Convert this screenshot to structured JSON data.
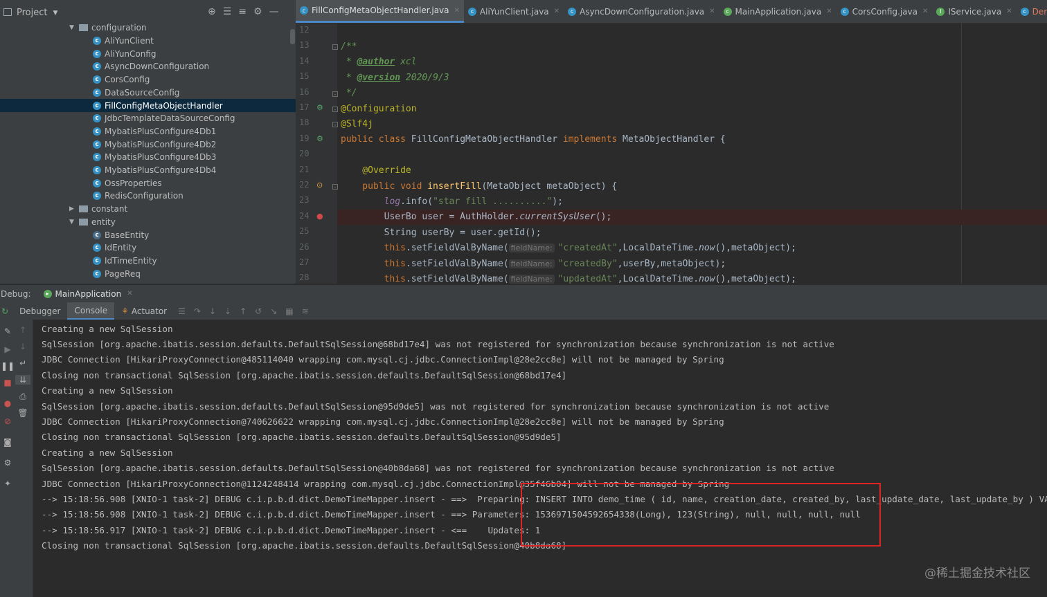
{
  "project_panel": {
    "title": "Project",
    "tree": [
      {
        "label": "configuration",
        "type": "folder",
        "open": true,
        "indent": 1
      },
      {
        "label": "AliYunClient",
        "type": "class",
        "indent": 2
      },
      {
        "label": "AliYunConfig",
        "type": "class",
        "indent": 2
      },
      {
        "label": "AsyncDownConfiguration",
        "type": "class",
        "indent": 2
      },
      {
        "label": "CorsConfig",
        "type": "class",
        "indent": 2
      },
      {
        "label": "DataSourceConfig",
        "type": "class",
        "indent": 2
      },
      {
        "label": "FillConfigMetaObjectHandler",
        "type": "class",
        "indent": 2,
        "selected": true
      },
      {
        "label": "JdbcTemplateDataSourceConfig",
        "type": "class",
        "indent": 2
      },
      {
        "label": "MybatisPlusConfigure4Db1",
        "type": "class",
        "indent": 2
      },
      {
        "label": "MybatisPlusConfigure4Db2",
        "type": "class",
        "indent": 2
      },
      {
        "label": "MybatisPlusConfigure4Db3",
        "type": "class",
        "indent": 2
      },
      {
        "label": "MybatisPlusConfigure4Db4",
        "type": "class",
        "indent": 2
      },
      {
        "label": "OssProperties",
        "type": "class",
        "indent": 2
      },
      {
        "label": "RedisConfiguration",
        "type": "class",
        "indent": 2
      },
      {
        "label": "constant",
        "type": "folder",
        "open": false,
        "indent": 1
      },
      {
        "label": "entity",
        "type": "folder",
        "open": true,
        "indent": 1
      },
      {
        "label": "BaseEntity",
        "type": "abstract",
        "indent": 2
      },
      {
        "label": "IdEntity",
        "type": "class",
        "indent": 2
      },
      {
        "label": "IdTimeEntity",
        "type": "class",
        "indent": 2
      },
      {
        "label": "PageReq",
        "type": "class",
        "indent": 2
      }
    ]
  },
  "editor_tabs": [
    {
      "label": "FillConfigMetaObjectHandler.java",
      "active": true,
      "icon": "class-icon"
    },
    {
      "label": "AliYunClient.java",
      "icon": "class-icon"
    },
    {
      "label": "AsyncDownConfiguration.java",
      "icon": "class-icon"
    },
    {
      "label": "MainApplication.java",
      "icon": "spring-class-icon"
    },
    {
      "label": "CorsConfig.java",
      "icon": "class-icon"
    },
    {
      "label": "IService.java",
      "icon": "interface-icon"
    },
    {
      "label": "DemoTime.java",
      "icon": "class-icon",
      "modified": true
    }
  ],
  "code": {
    "line_numbers": [
      "12",
      "13",
      "14",
      "15",
      "16",
      "17",
      "18",
      "19",
      "20",
      "21",
      "22",
      "23",
      "24",
      "25",
      "26",
      "27",
      "28"
    ],
    "lines": [
      {
        "parts": []
      },
      {
        "parts": [
          {
            "t": "/**",
            "c": "doc"
          }
        ]
      },
      {
        "parts": [
          {
            "t": " * ",
            "c": "doc"
          },
          {
            "t": "@author",
            "c": "doctag"
          },
          {
            "t": " xcl",
            "c": "doc"
          }
        ]
      },
      {
        "parts": [
          {
            "t": " * ",
            "c": "doc"
          },
          {
            "t": "@version",
            "c": "doctag"
          },
          {
            "t": " 2020/9/3",
            "c": "doc"
          }
        ]
      },
      {
        "parts": [
          {
            "t": " */",
            "c": "doc"
          }
        ]
      },
      {
        "parts": [
          {
            "t": "@Configuration",
            "c": "ann"
          }
        ]
      },
      {
        "parts": [
          {
            "t": "@Slf4j",
            "c": "ann"
          }
        ]
      },
      {
        "parts": [
          {
            "t": "public class ",
            "c": "kw"
          },
          {
            "t": "FillConfigMetaObjectHandler ",
            "c": ""
          },
          {
            "t": "implements ",
            "c": "kw"
          },
          {
            "t": "MetaObjectHandler {",
            "c": ""
          }
        ]
      },
      {
        "parts": []
      },
      {
        "parts": [
          {
            "t": "    @Override",
            "c": "ann"
          }
        ]
      },
      {
        "parts": [
          {
            "t": "    public void ",
            "c": "kw"
          },
          {
            "t": "insertFill",
            "c": "fn"
          },
          {
            "t": "(MetaObject metaObject) {",
            "c": ""
          }
        ]
      },
      {
        "parts": [
          {
            "t": "        ",
            "c": ""
          },
          {
            "t": "log",
            "c": "field"
          },
          {
            "t": ".info(",
            "c": ""
          },
          {
            "t": "\"star fill ..........\"",
            "c": "str"
          },
          {
            "t": ");",
            "c": ""
          }
        ]
      },
      {
        "parts": [
          {
            "t": "        UserBo user = AuthHolder.",
            "c": ""
          },
          {
            "t": "currentSysUser",
            "c": "ital"
          },
          {
            "t": "();",
            "c": ""
          }
        ],
        "breakpoint": true
      },
      {
        "parts": [
          {
            "t": "        String userBy = user.getId();",
            "c": ""
          }
        ]
      },
      {
        "parts": [
          {
            "t": "        ",
            "c": ""
          },
          {
            "t": "this",
            "c": "kw"
          },
          {
            "t": ".setFieldValByName(",
            "c": ""
          },
          {
            "t": "fieldName:",
            "c": "hint"
          },
          {
            "t": "\"createdAt\"",
            "c": "str"
          },
          {
            "t": ",LocalDateTime.",
            "c": ""
          },
          {
            "t": "now",
            "c": "ital"
          },
          {
            "t": "(),metaObject);",
            "c": ""
          }
        ]
      },
      {
        "parts": [
          {
            "t": "        ",
            "c": ""
          },
          {
            "t": "this",
            "c": "kw"
          },
          {
            "t": ".setFieldValByName(",
            "c": ""
          },
          {
            "t": "fieldName:",
            "c": "hint"
          },
          {
            "t": "\"createdBy\"",
            "c": "str"
          },
          {
            "t": ",userBy,metaObject);",
            "c": ""
          }
        ]
      },
      {
        "parts": [
          {
            "t": "        ",
            "c": ""
          },
          {
            "t": "this",
            "c": "kw"
          },
          {
            "t": ".setFieldValByName(",
            "c": ""
          },
          {
            "t": "fieldName:",
            "c": "hint"
          },
          {
            "t": "\"updatedAt\"",
            "c": "str"
          },
          {
            "t": ",LocalDateTime.",
            "c": ""
          },
          {
            "t": "now",
            "c": "ital"
          },
          {
            "t": "(),metaObject);",
            "c": ""
          }
        ]
      }
    ]
  },
  "debug": {
    "label": "Debug:",
    "config": "MainApplication",
    "tabs": [
      "Debugger",
      "Console",
      "Actuator"
    ],
    "active_tab": "Console"
  },
  "console_lines": [
    "Creating a new SqlSession",
    "SqlSession [org.apache.ibatis.session.defaults.DefaultSqlSession@68bd17e4] was not registered for synchronization because synchronization is not active",
    "JDBC Connection [HikariProxyConnection@485114040 wrapping com.mysql.cj.jdbc.ConnectionImpl@28e2cc8e] will not be managed by Spring",
    "Closing non transactional SqlSession [org.apache.ibatis.session.defaults.DefaultSqlSession@68bd17e4]",
    "Creating a new SqlSession",
    "SqlSession [org.apache.ibatis.session.defaults.DefaultSqlSession@95d9de5] was not registered for synchronization because synchronization is not active",
    "JDBC Connection [HikariProxyConnection@740626622 wrapping com.mysql.cj.jdbc.ConnectionImpl@28e2cc8e] will not be managed by Spring",
    "Closing non transactional SqlSession [org.apache.ibatis.session.defaults.DefaultSqlSession@95d9de5]",
    "Creating a new SqlSession",
    "SqlSession [org.apache.ibatis.session.defaults.DefaultSqlSession@40b8da68] was not registered for synchronization because synchronization is not active",
    "JDBC Connection [HikariProxyConnection@1124248414 wrapping com.mysql.cj.jdbc.ConnectionImpl@35f46b04] will not be managed by Spring",
    "--> 15:18:56.908 [XNIO-1 task-2] DEBUG c.i.p.b.d.dict.DemoTimeMapper.insert - ==>  Preparing: INSERT INTO demo_time ( id, name, creation_date, created_by, last_update_date, last_update_by ) VALUES",
    "--> 15:18:56.908 [XNIO-1 task-2] DEBUG c.i.p.b.d.dict.DemoTimeMapper.insert - ==> Parameters: 1536971504592654338(Long), 123(String), null, null, null, null",
    "--> 15:18:56.917 [XNIO-1 task-2] DEBUG c.i.p.b.d.dict.DemoTimeMapper.insert - <==    Updates: 1",
    "Closing non transactional SqlSession [org.apache.ibatis.session.defaults.DefaultSqlSession@40b8da68]"
  ],
  "watermark": "@稀土掘金技术社区",
  "colors": {
    "highlight_box": "#e02424",
    "selection": "#0d293e",
    "accent": "#4a88c7"
  }
}
